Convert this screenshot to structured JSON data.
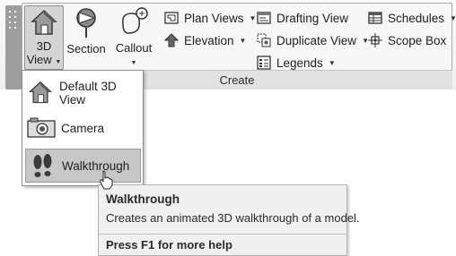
{
  "ribbon": {
    "panel_title": "Create",
    "big_buttons": {
      "view3d_line1": "3D",
      "view3d_line2": "View",
      "section": "Section",
      "callout": "Callout"
    },
    "small_buttons": {
      "plan_views": "Plan Views",
      "elevation": "Elevation",
      "drafting_view": "Drafting View",
      "duplicate_view": "Duplicate View",
      "legends": "Legends",
      "schedules": "Schedules",
      "scope_box": "Scope Box"
    },
    "icons": [
      "house-3d-icon",
      "section-icon",
      "callout-icon",
      "plan-views-icon",
      "elevation-icon",
      "drafting-view-icon",
      "duplicate-view-icon",
      "legends-icon",
      "schedules-icon",
      "scope-box-icon"
    ]
  },
  "dropdown": {
    "items": [
      {
        "label": "Default 3D View",
        "icon": "house-3d-icon"
      },
      {
        "label": "Camera",
        "icon": "camera-icon"
      },
      {
        "label": "Walkthrough",
        "icon": "footprints-icon",
        "highlighted": true
      }
    ]
  },
  "tooltip": {
    "title": "Walkthrough",
    "description": "Creates an animated 3D walkthrough of a model.",
    "help": "Press F1 for more help"
  }
}
